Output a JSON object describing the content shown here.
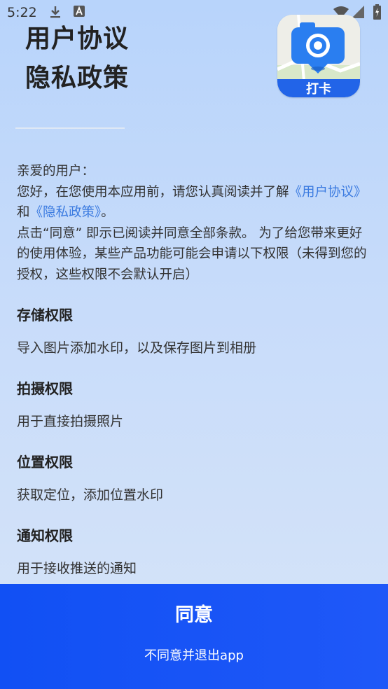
{
  "status_bar": {
    "time": "5:22"
  },
  "header": {
    "title_line1": "用户协议",
    "title_line2": "隐私政策"
  },
  "logo": {
    "badge_text": "打卡"
  },
  "intro": {
    "greeting": "亲爱的用户：",
    "para1_prefix": "您好，在您使用本应用前，请您认真阅读并了解",
    "user_agreement_link": "《用户协议》",
    "and_text": "和",
    "privacy_policy_link": "《隐私政策》",
    "para1_suffix": "。",
    "para2": "点击“同意” 即示已阅读并同意全部条款。 为了给您带来更好的使用体验，某些产品功能可能会申请以下权限（未得到您的授权，这些权限不会默认开启）"
  },
  "permissions": [
    {
      "title": "存储权限",
      "desc": "导入图片添加水印，以及保存图片到相册"
    },
    {
      "title": "拍摄权限",
      "desc": "用于直接拍摄照片"
    },
    {
      "title": "位置权限",
      "desc": "获取定位，添加位置水印"
    },
    {
      "title": "通知权限",
      "desc": "用于接收推送的通知"
    }
  ],
  "footer": {
    "agree_label": "同意",
    "disagree_label": "不同意并退出app"
  },
  "colors": {
    "accent": "#1150f4",
    "link": "#3b7be0"
  }
}
